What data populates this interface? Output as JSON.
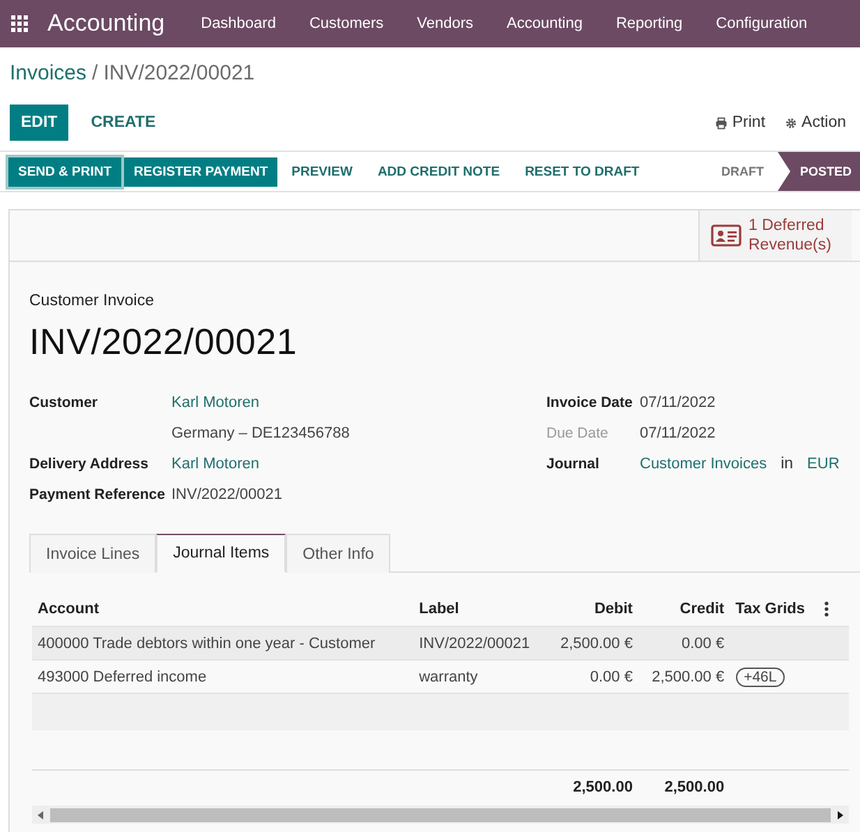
{
  "navbar": {
    "app_title": "Accounting",
    "menu": [
      "Dashboard",
      "Customers",
      "Vendors",
      "Accounting",
      "Reporting",
      "Configuration"
    ]
  },
  "breadcrumb": {
    "parent": "Invoices",
    "separator": "/",
    "current": "INV/2022/00021"
  },
  "control_buttons": [
    {
      "label": "EDIT",
      "kind": "primary"
    },
    {
      "label": "CREATE",
      "kind": "link"
    }
  ],
  "actions": [
    {
      "label": "Print",
      "kind": "print"
    },
    {
      "label": "Action",
      "kind": "gear"
    }
  ],
  "status_buttons": [
    {
      "label": "SEND & PRINT",
      "kind": "primary",
      "focused": true
    },
    {
      "label": "REGISTER PAYMENT",
      "kind": "primary",
      "focused": false
    },
    {
      "label": "PREVIEW",
      "kind": "link",
      "focused": false
    },
    {
      "label": "ADD CREDIT NOTE",
      "kind": "link",
      "focused": false
    },
    {
      "label": "RESET TO DRAFT",
      "kind": "link",
      "focused": false
    }
  ],
  "stages": [
    {
      "label": "DRAFT",
      "selected": false
    },
    {
      "label": "POSTED",
      "selected": true
    }
  ],
  "smart_button": {
    "label": "1 Deferred Revenue(s)"
  },
  "form": {
    "type_label": "Customer Invoice",
    "name": "INV/2022/00021",
    "left_fields": [
      {
        "label": "Customer",
        "value": "Karl Motoren",
        "kind": "link"
      },
      {
        "value": "Germany – DE123456788",
        "kind": "text"
      },
      {
        "label": "Delivery Address",
        "value": "Karl Motoren",
        "kind": "link"
      },
      {
        "label": "Payment Reference",
        "value": "INV/2022/00021",
        "kind": "text"
      }
    ],
    "right_fields": [
      {
        "label": "Invoice Date",
        "value": "07/11/2022",
        "muted": false
      },
      {
        "label": "Due Date",
        "value": "07/11/2022",
        "muted": true
      },
      {
        "label": "Journal",
        "value": "Customer Invoices",
        "joiner": "in",
        "currency": "EUR",
        "muted": false
      }
    ]
  },
  "tabs": [
    {
      "label": "Invoice Lines",
      "selected": false
    },
    {
      "label": "Journal Items",
      "selected": true
    },
    {
      "label": "Other Info",
      "selected": false
    }
  ],
  "table": {
    "columns": [
      "Account",
      "Label",
      "Debit",
      "Credit",
      "Tax Grids"
    ],
    "rows": [
      {
        "account": "400000 Trade debtors within one year - Customer",
        "label": "INV/2022/00021",
        "debit": "2,500.00 €",
        "credit": "0.00 €",
        "selected": true
      },
      {
        "account": "493000 Deferred income",
        "label": "warranty",
        "debit": "0.00 €",
        "credit": "2,500.00 €",
        "tax_grid": "+46L",
        "selected": false
      }
    ],
    "totals": {
      "debit": "2,500.00",
      "credit": "2,500.00"
    }
  }
}
